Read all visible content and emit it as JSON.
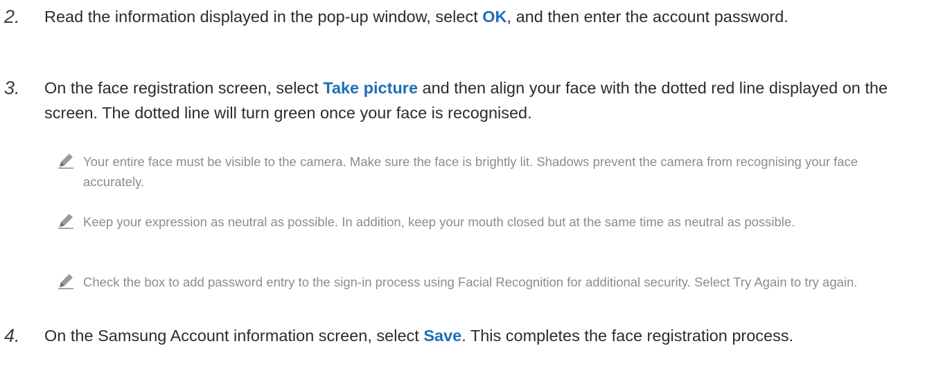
{
  "steps": [
    {
      "number": "2.",
      "before": "Read the information displayed in the pop-up window, select ",
      "highlight": "OK",
      "after": ", and then enter the account password."
    },
    {
      "number": "3.",
      "before": "On the face registration screen, select ",
      "highlight": "Take picture",
      "after": " and then align your face with the dotted red line displayed on the screen. The dotted line will turn green once your face is recognised."
    },
    {
      "number": "4.",
      "before": "On the Samsung Account information screen, select ",
      "highlight": "Save",
      "after": ". This completes the face registration process."
    }
  ],
  "notes": [
    "Your entire face must be visible to the camera. Make sure the face is brightly lit. Shadows prevent the camera from recognising your face accurately.",
    "Keep your expression as neutral as possible. In addition, keep your mouth closed but at the same time as neutral as possible.",
    "Check the box to add password entry to the sign-in process using Facial Recognition for additional security. Select Try Again to try again."
  ],
  "colors": {
    "highlight": "#1d6fb8",
    "body_text": "#2b2b2b",
    "note_text": "#8c8c8c"
  },
  "icons": {
    "note": "pencil-icon"
  }
}
